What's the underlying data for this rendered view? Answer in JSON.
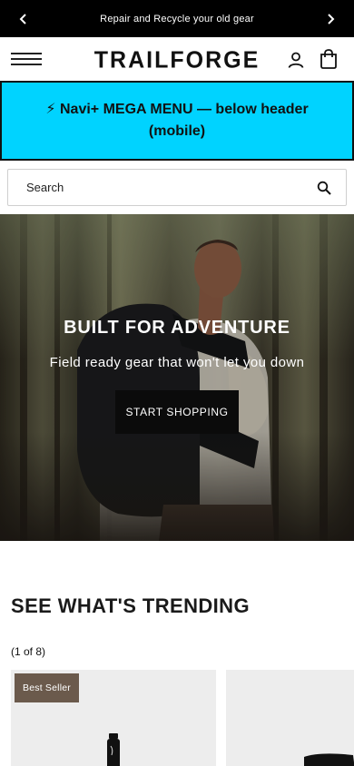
{
  "announcement": {
    "text": "Repair and Recycle your old gear",
    "prev_icon": "chevron-left-icon",
    "next_icon": "chevron-right-icon"
  },
  "header": {
    "logo": "TRAILFORGE",
    "menu_icon": "hamburger-menu-icon",
    "account_icon": "user-icon",
    "cart_icon": "shopping-bag-icon"
  },
  "mega_menu": {
    "label": "⚡ Navi+ MEGA MENU — below header (mobile)",
    "color": "#00d3ff"
  },
  "search": {
    "placeholder": "Search",
    "icon": "search-icon"
  },
  "hero": {
    "title": "BUILT FOR ADVENTURE",
    "subtitle": "Field ready gear that won't let you down",
    "cta_label": "START SHOPPING"
  },
  "trending": {
    "title": "SEE WHAT'S TRENDING",
    "count": "(1 of 8)",
    "products": [
      {
        "badge": "Best Seller"
      },
      {
        "badge": ""
      }
    ]
  },
  "colors": {
    "announcement_bg": "#000000",
    "badge_bg": "#6b5a4c",
    "button_bg": "#0b0b0b"
  }
}
